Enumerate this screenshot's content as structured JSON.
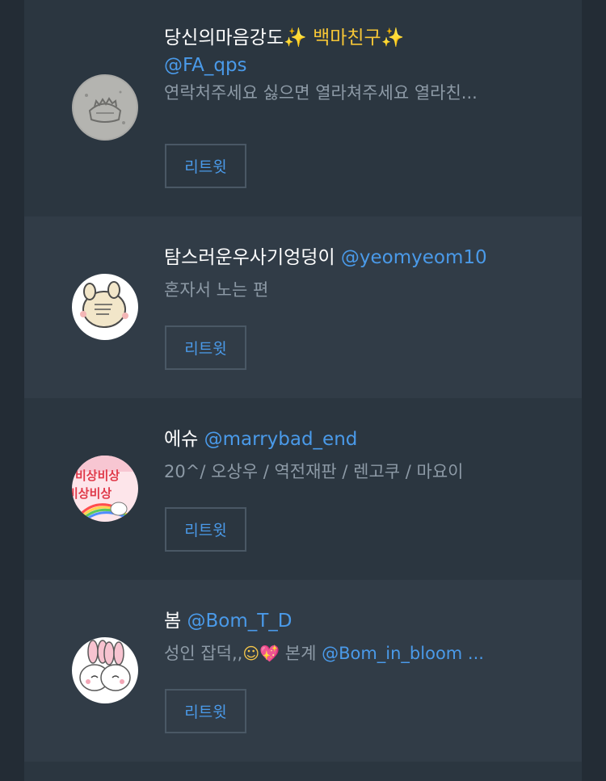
{
  "users": [
    {
      "name": "당신의마음강도",
      "name_suffix": "✨ 백마친구✨",
      "handle": "@FA_qps",
      "bio": "연락처주세요 싫으면 열라쳐주세요 열라친...",
      "button": "리트윗"
    },
    {
      "name": "탐스러운우사기엉덩이",
      "handle": "@yeomyeom10",
      "bio": "혼자서 노는 편",
      "button": "리트윗"
    },
    {
      "name": "에슈",
      "handle": "@marrybad_end",
      "bio": "20^/ 오상우 / 역전재판 / 렌고쿠 / 마요이",
      "button": "리트윗"
    },
    {
      "name": "봄",
      "handle": "@Bom_T_D",
      "bio_prefix": "성인 잡덕,,",
      "bio_emoji1": "☺",
      "bio_emoji2": "💖",
      "bio_mid": " 본계 ",
      "bio_mention": "@Bom_in_bloom ...",
      "button": "리트윗"
    }
  ],
  "colors": {
    "background": "#232c35",
    "row": "#2b3640",
    "row_alt": "#313c47",
    "accent": "#4a9ae9",
    "muted": "#8d9aa6",
    "border": "#4a5865"
  }
}
